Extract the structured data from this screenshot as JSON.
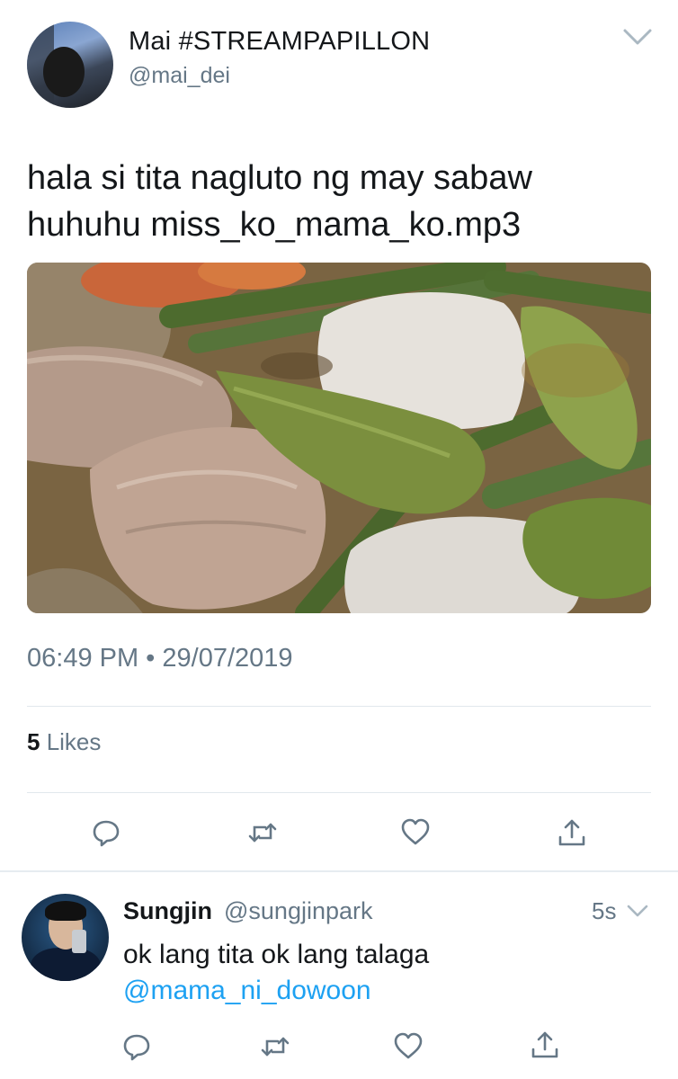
{
  "tweet": {
    "display_name": "Mai #STREAMPAPILLON",
    "handle": "@mai_dei",
    "text_line1": "hala si tita nagluto ng may sabaw",
    "text_line2": "huhuhu miss_ko_mama_ko.mp3",
    "timestamp": "06:49 PM • 29/07/2019",
    "likes_count": "5",
    "likes_label": " Likes"
  },
  "reply": {
    "name": "Sungjin",
    "handle": "@sungjinpark",
    "time": "5s",
    "text": "ok lang tita ok lang talaga",
    "mention": "@mama_ni_dowoon"
  },
  "icons": {
    "reply": "reply-icon",
    "retweet": "retweet-icon",
    "like": "heart-icon",
    "share": "share-icon",
    "caret": "chevron-down-icon"
  },
  "colors": {
    "text": "#14171a",
    "secondary": "#657786",
    "link": "#1da1f2",
    "divider": "#e1e8ed"
  }
}
